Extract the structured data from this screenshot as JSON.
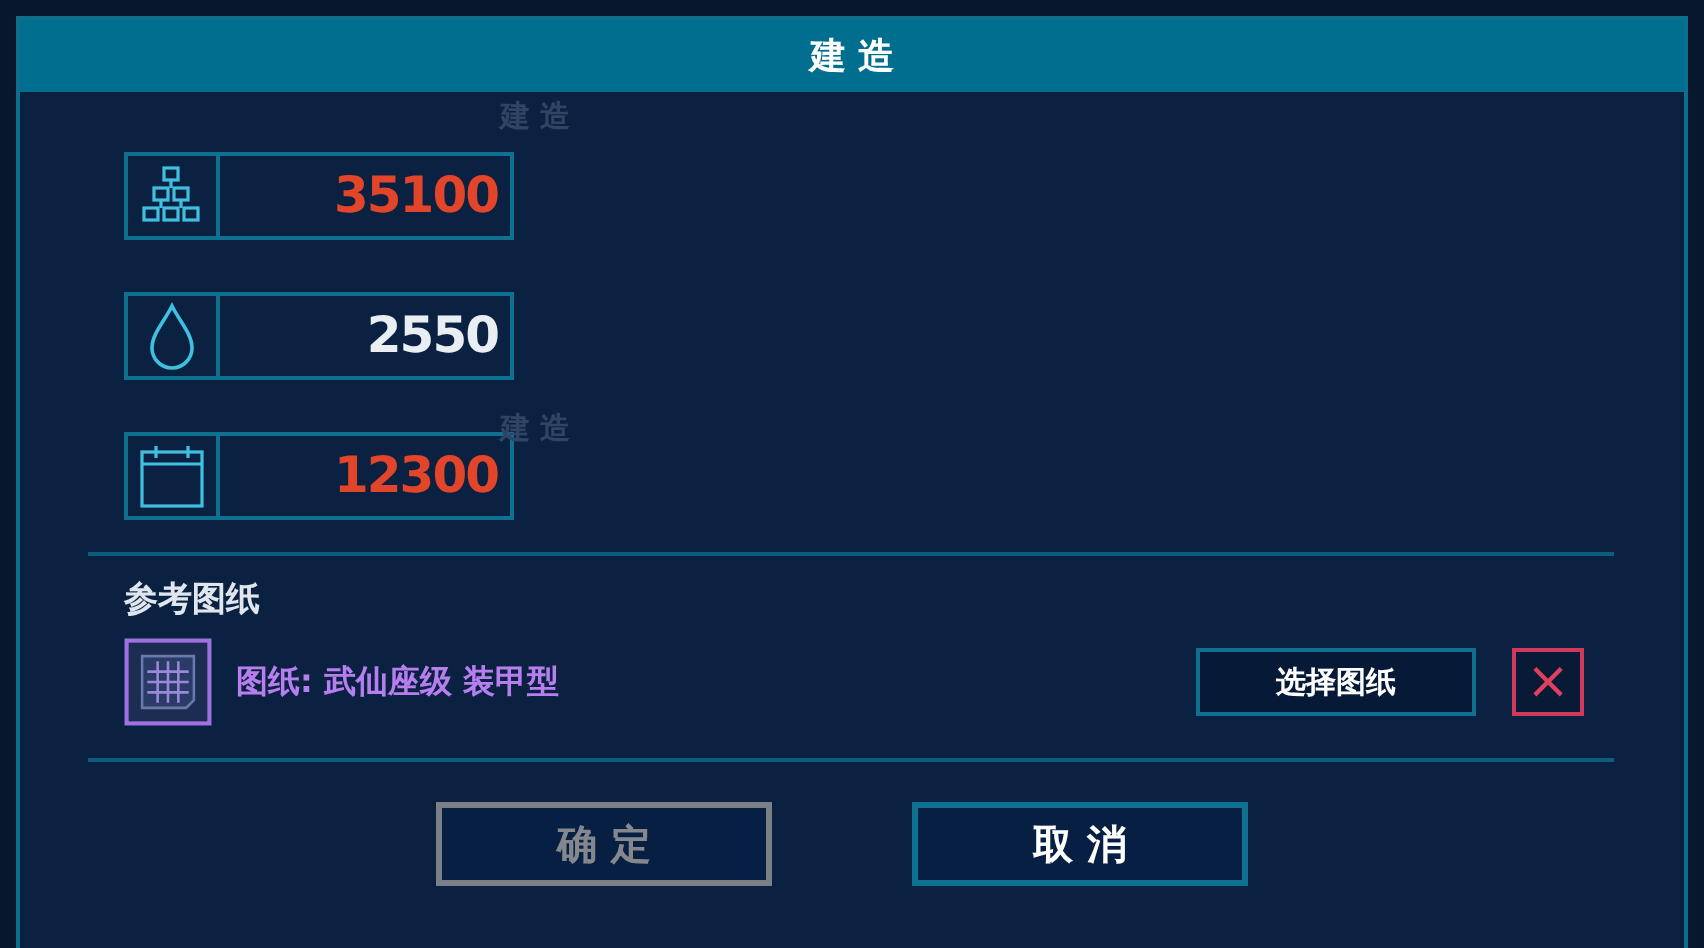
{
  "dialog": {
    "title": "建 造"
  },
  "background_labels": [
    "建 造",
    "建 造"
  ],
  "resources": [
    {
      "kind": "blocks",
      "value": "35100",
      "insufficient": true
    },
    {
      "kind": "drop",
      "value": "2550",
      "insufficient": false
    },
    {
      "kind": "calendar",
      "value": "12300",
      "insufficient": true
    }
  ],
  "blueprint": {
    "heading": "参考图纸",
    "name": "图纸: 武仙座级 装甲型",
    "select_button": "选择图纸",
    "clear_button": "×"
  },
  "buttons": [
    {
      "label": "确 定",
      "disabled": true
    },
    {
      "label": "取 消",
      "disabled": false
    }
  ]
}
